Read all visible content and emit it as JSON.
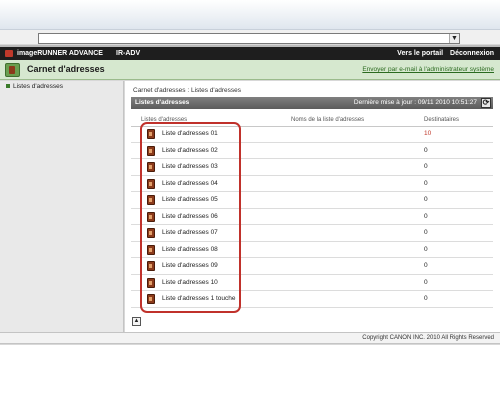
{
  "app": {
    "name": "imageRUNNER ADVANCE",
    "device": "IR-ADV",
    "portal_link": "Vers le portail",
    "logout_link": "Déconnexion"
  },
  "header": {
    "title": "Carnet d'adresses",
    "email_admin_link": "Envoyer par e-mail à l'administrateur système"
  },
  "sidebar": {
    "items": [
      {
        "label": "Listes d'adresses"
      }
    ]
  },
  "main": {
    "breadcrumb": "Carnet d'adresses : Listes d'adresses",
    "panel_title": "Listes d'adresses",
    "last_update": "Dernière mise à jour : 09/11 2010 10:51:27",
    "columns": [
      "Listes d'adresses",
      "Noms de la liste d'adresses",
      "Destinataires"
    ],
    "rows": [
      {
        "label": "Liste d'adresses 01",
        "count": "10"
      },
      {
        "label": "Liste d'adresses 02",
        "count": "0"
      },
      {
        "label": "Liste d'adresses 03",
        "count": "0"
      },
      {
        "label": "Liste d'adresses 04",
        "count": "0"
      },
      {
        "label": "Liste d'adresses 05",
        "count": "0"
      },
      {
        "label": "Liste d'adresses 06",
        "count": "0"
      },
      {
        "label": "Liste d'adresses 07",
        "count": "0"
      },
      {
        "label": "Liste d'adresses 08",
        "count": "0"
      },
      {
        "label": "Liste d'adresses 09",
        "count": "0"
      },
      {
        "label": "Liste d'adresses 10",
        "count": "0"
      },
      {
        "label": "Liste d'adresses 1 touche",
        "count": "0"
      }
    ]
  },
  "footer": {
    "copyright": "Copyright CANON INC. 2010 All Rights Reserved"
  },
  "colors": {
    "accent_green": "#6a9e4f",
    "highlight_red": "#c0312b",
    "header_dark": "#1e1e1e"
  },
  "icons": {
    "refresh": "refresh-icon",
    "scroll_top": "arrow-up-icon",
    "list": "address-book-icon"
  }
}
